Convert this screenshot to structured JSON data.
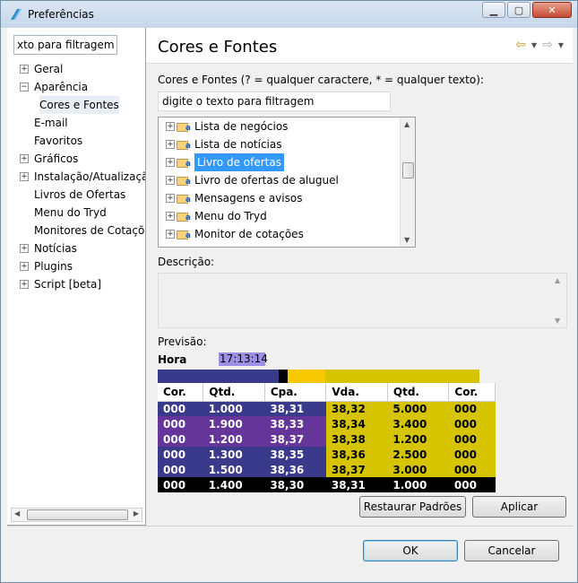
{
  "window": {
    "title": "Preferências"
  },
  "left": {
    "filter_value": "xto para filtragem",
    "tree": [
      {
        "label": "Geral",
        "expander": "+"
      },
      {
        "label": "Aparência",
        "expander": "−"
      },
      {
        "label": "Cores e Fontes",
        "child": true,
        "selected": true
      },
      {
        "label": "E-mail",
        "expander": ""
      },
      {
        "label": "Favoritos",
        "expander": ""
      },
      {
        "label": "Gráficos",
        "expander": "+"
      },
      {
        "label": "Instalação/Atualizaçã",
        "expander": "+"
      },
      {
        "label": "Livros de Ofertas",
        "expander": ""
      },
      {
        "label": "Menu do Tryd",
        "expander": ""
      },
      {
        "label": "Monitores de Cotaçõ",
        "expander": ""
      },
      {
        "label": "Notícias",
        "expander": "+"
      },
      {
        "label": "Plugins",
        "expander": "+"
      },
      {
        "label": "Script [beta]",
        "expander": "+"
      }
    ]
  },
  "page": {
    "title": "Cores e Fontes",
    "filter_label": "Cores e Fontes (? = qualquer caractere, * = qualquer texto):",
    "filter_placeholder": "digite o texto para filtragem",
    "list": [
      {
        "label": "Lista de negócios"
      },
      {
        "label": "Lista de notícias"
      },
      {
        "label": "Livro de ofertas",
        "selected": true
      },
      {
        "label": "Livro de ofertas de aluguel"
      },
      {
        "label": "Mensagens e avisos"
      },
      {
        "label": "Menu do Tryd"
      },
      {
        "label": "Monitor de cotações"
      }
    ],
    "description_label": "Descrição:",
    "preview_label": "Previsão:",
    "preview": {
      "hora_label": "Hora",
      "hora_value": "17:13:14",
      "headers": [
        "Cor.",
        "Qtd.",
        "Cpa.",
        "Vda.",
        "Qtd.",
        "Cor."
      ],
      "rows": [
        {
          "style": [
            "c-blue",
            "c-blue",
            "c-blue",
            "c-yel",
            "c-yel",
            "c-yel"
          ],
          "cells": [
            "000",
            "1.000",
            "38,31",
            "38,32",
            "5.000",
            "000"
          ]
        },
        {
          "style": [
            "c-purp",
            "c-purp",
            "c-purp",
            "c-yel",
            "c-yel",
            "c-yel"
          ],
          "cells": [
            "000",
            "1.900",
            "38,33",
            "38,34",
            "3.400",
            "000"
          ]
        },
        {
          "style": [
            "c-purp",
            "c-purp",
            "c-purp",
            "c-yel",
            "c-yel",
            "c-yel"
          ],
          "cells": [
            "000",
            "1.200",
            "38,37",
            "38,38",
            "1.200",
            "000"
          ]
        },
        {
          "style": [
            "c-blue",
            "c-blue",
            "c-blue",
            "c-yel",
            "c-yel",
            "c-yel"
          ],
          "cells": [
            "000",
            "1.300",
            "38,35",
            "38,36",
            "2.500",
            "000"
          ]
        },
        {
          "style": [
            "c-blue",
            "c-blue",
            "c-blue",
            "c-yel",
            "c-yel",
            "c-yel"
          ],
          "cells": [
            "000",
            "1.500",
            "38,36",
            "38,37",
            "3.000",
            "000"
          ]
        },
        {
          "style": [
            "c-blk",
            "c-blk",
            "c-blk",
            "c-blk",
            "c-blk",
            "c-blk"
          ],
          "cells": [
            "000",
            "1.400",
            "38,30",
            "38,31",
            "1.000",
            "000"
          ]
        }
      ]
    },
    "restore_label": "Restaurar Padrões",
    "apply_label": "Aplicar"
  },
  "footer": {
    "ok_label": "OK",
    "cancel_label": "Cancelar"
  },
  "colors": {
    "selection": "#3399ff",
    "hora_bg": "#9d8fe8",
    "bid_blue": "#3a3a8c",
    "bid_purple": "#65359a",
    "ask_yellow": "#d6c400",
    "ask_orange": "#f5c800"
  }
}
